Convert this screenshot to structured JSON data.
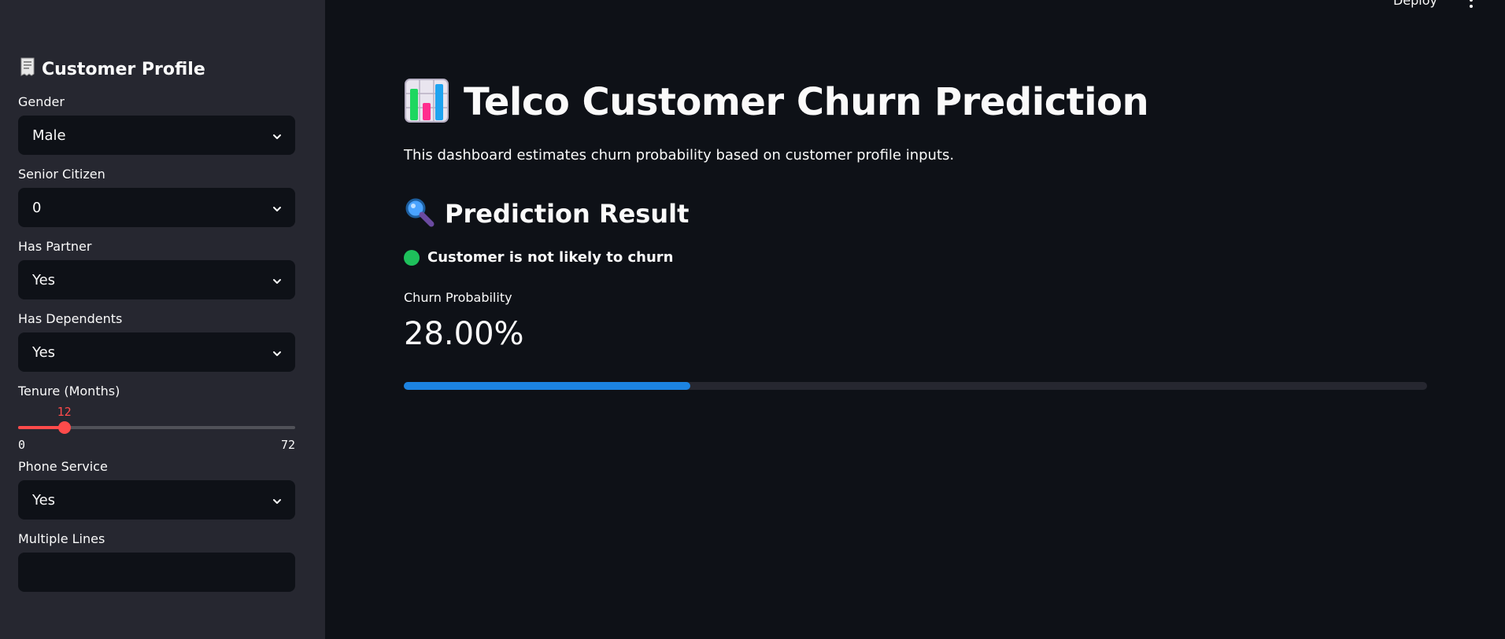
{
  "sidebar": {
    "header_icon": "receipt-emoji",
    "header": "Customer Profile",
    "fields": [
      {
        "label": "Gender",
        "value": "Male"
      },
      {
        "label": "Senior Citizen",
        "value": "0"
      },
      {
        "label": "Has Partner",
        "value": "Yes"
      },
      {
        "label": "Has Dependents",
        "value": "Yes"
      }
    ],
    "tenure": {
      "label": "Tenure (Months)",
      "value": 12,
      "value_text": "12",
      "min": 0,
      "max": 72,
      "min_text": "0",
      "max_text": "72"
    },
    "fields_after": [
      {
        "label": "Phone Service",
        "value": "Yes"
      },
      {
        "label": "Multiple Lines",
        "value": ""
      }
    ]
  },
  "topbar": {
    "deploy_label": "Deploy",
    "menu_icon": "kebab-menu-icon"
  },
  "main": {
    "title_icon": "bar-chart-emoji",
    "title": "Telco Customer Churn Prediction",
    "description": "This dashboard estimates churn probability based on customer profile inputs.",
    "result_icon": "magnifier-emoji",
    "result_header": "Prediction Result",
    "status_icon": "green-circle",
    "status_text": "Customer is not likely to churn",
    "metric_label": "Churn Probability",
    "metric_value": "28.00%",
    "progress": 0.28
  },
  "colors": {
    "background": "#0e1117",
    "sidebar": "#262730",
    "accent_red": "#ff4b4b",
    "progress_blue": "#1c83e1",
    "status_green": "#1ec05b"
  }
}
